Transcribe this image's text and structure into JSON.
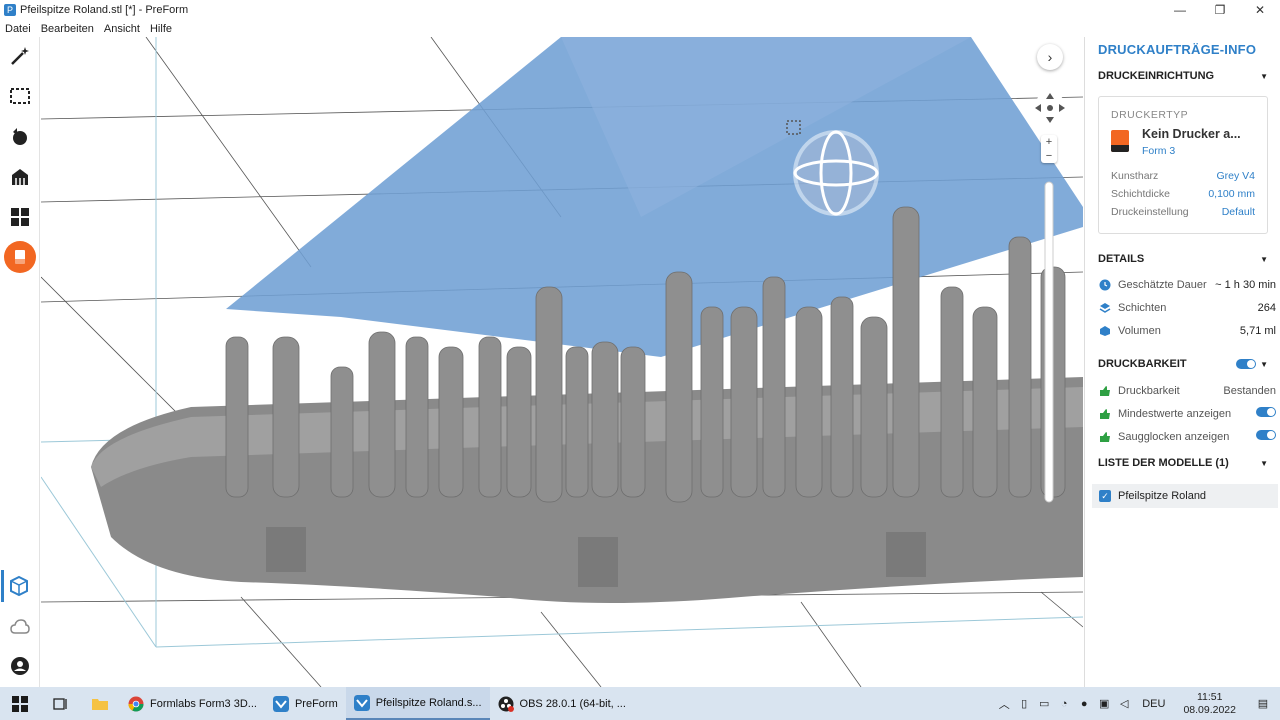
{
  "window": {
    "title": "Pfeilspitze Roland.stl [*] - PreForm",
    "minimize": "—",
    "maximize": "❐",
    "close": "✕"
  },
  "menu": [
    "Datei",
    "Bearbeiten",
    "Ansicht",
    "Hilfe"
  ],
  "left_toolbar": {
    "icons": [
      "magic-wand-icon",
      "select-region-icon",
      "orientation-icon",
      "supports-icon",
      "layout-icon",
      "print-icon",
      "model-view-icon",
      "cloud-icon",
      "account-icon"
    ]
  },
  "viewport": {
    "next_button": "›",
    "zoom_in": "+",
    "zoom_out": "−"
  },
  "panel": {
    "title": "DRUCKAUFTRÄGE-INFO",
    "setup": {
      "heading": "DRUCKEINRICHTUNG",
      "printer_type_label": "DRUCKERTYP",
      "printer_name": "Kein Drucker a...",
      "printer_model": "Form 3",
      "rows": [
        {
          "label": "Kunstharz",
          "value": "Grey V4"
        },
        {
          "label": "Schichtdicke",
          "value": "0,100 mm"
        },
        {
          "label": "Druckeinstellung",
          "value": "Default"
        }
      ]
    },
    "details": {
      "heading": "DETAILS",
      "rows": [
        {
          "label": "Geschätzte Dauer",
          "value": "~ 1 h 30 min"
        },
        {
          "label": "Schichten",
          "value": "264"
        },
        {
          "label": "Volumen",
          "value": "5,71 ml"
        }
      ]
    },
    "printability": {
      "heading": "DRUCKBARKEIT",
      "rows": [
        {
          "label": "Druckbarkeit",
          "value": "Bestanden"
        },
        {
          "label": "Mindestwerte anzeigen",
          "value": ""
        },
        {
          "label": "Saugglocken anzeigen",
          "value": ""
        }
      ]
    },
    "models": {
      "heading": "LISTE DER MODELLE (1)",
      "items": [
        "Pfeilspitze Roland"
      ]
    }
  },
  "taskbar": {
    "apps": [
      {
        "label": "Formlabs Form3 3D...",
        "color": "#ffffff"
      },
      {
        "label": "PreForm",
        "color": "#2f80c8"
      },
      {
        "label": "Pfeilspitze Roland.s...",
        "color": "#2f80c8"
      },
      {
        "label": "OBS 28.0.1 (64-bit, ...",
        "color": "#222222"
      }
    ],
    "language": "DEU",
    "time": "11:51",
    "date": "08.09.2022"
  },
  "colors": {
    "accent": "#2f80c8",
    "brand_orange": "#f26722",
    "model_gray": "#8a8a8a",
    "platform_blue": "#6f9fd4"
  }
}
